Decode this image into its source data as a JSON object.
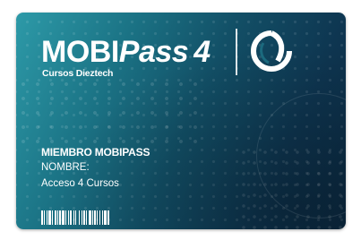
{
  "card": {
    "brand_main": "MOBI",
    "brand_pass": "Pass",
    "brand_number": "4",
    "subbrand": "Cursos Dieztech",
    "member_title": "MIEMBRO MOBIPASS",
    "name_label": "NOMBRE:",
    "access_text": "Acceso 4 Cursos"
  },
  "icons": {
    "emblem": "circular-swoosh-logo-icon",
    "barcode": "barcode-icon"
  },
  "colors": {
    "gradient_light": "#2d9aa8",
    "gradient_dark": "#0b2a42",
    "text": "#ffffff"
  }
}
